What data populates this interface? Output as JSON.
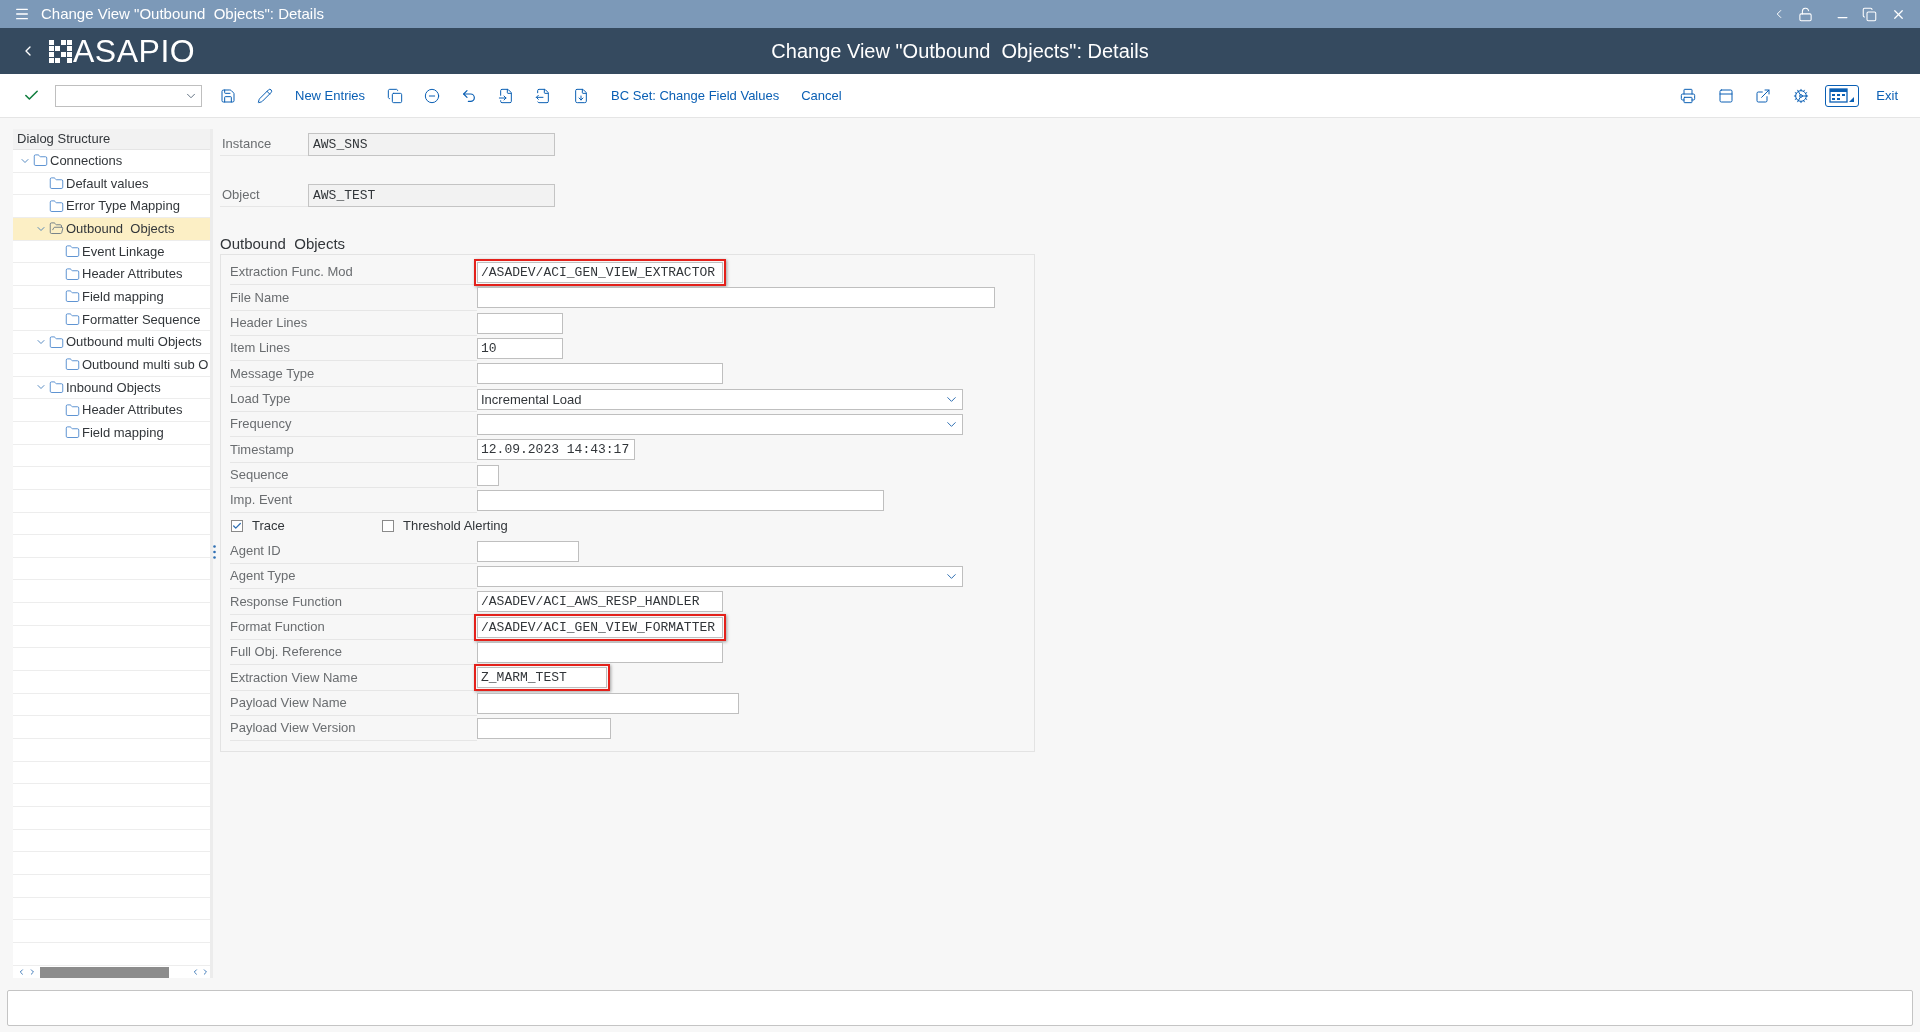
{
  "window": {
    "title": "Change View \"Outbound  Objects\": Details"
  },
  "header": {
    "logo": "ASAPIO",
    "title": "Change View \"Outbound  Objects\": Details"
  },
  "toolbar": {
    "buttons": [
      "New Entries",
      "BC Set: Change Field Values",
      "Cancel"
    ],
    "exit": "Exit"
  },
  "sidebar": {
    "title": "Dialog Structure",
    "items": [
      {
        "label": "Connections",
        "expanded": true,
        "selected": false,
        "children": [
          {
            "label": "Default values",
            "selected": false
          },
          {
            "label": "Error Type Mapping",
            "selected": false
          },
          {
            "label": "Outbound  Objects",
            "expanded": true,
            "selected": true,
            "children": [
              {
                "label": "Event Linkage",
                "selected": false
              },
              {
                "label": "Header Attributes",
                "selected": false
              },
              {
                "label": "Field mapping",
                "selected": false
              },
              {
                "label": "Formatter Sequence",
                "selected": false
              }
            ]
          },
          {
            "label": "Outbound multi Objects",
            "expanded": true,
            "selected": false,
            "children": [
              {
                "label": "Outbound multi sub O",
                "selected": false
              }
            ]
          },
          {
            "label": "Inbound Objects",
            "expanded": true,
            "selected": false,
            "children": [
              {
                "label": "Header Attributes",
                "selected": false
              },
              {
                "label": "Field mapping",
                "selected": false
              }
            ]
          }
        ]
      }
    ]
  },
  "key_fields": [
    {
      "label": "Instance",
      "value": "AWS_SNS"
    },
    {
      "label": "Object",
      "value": "AWS_TEST"
    }
  ],
  "section": {
    "title": "Outbound  Objects",
    "fields": [
      {
        "kind": "input",
        "label": "Extraction Func. Mod",
        "value": "/ASADEV/ACI_GEN_VIEW_EXTRACTOR",
        "highlighted": true
      },
      {
        "kind": "input",
        "label": "File Name",
        "highlighted": false
      },
      {
        "kind": "input",
        "label": "Header Lines",
        "highlighted": false
      },
      {
        "kind": "input",
        "label": "Item Lines",
        "value": "10",
        "highlighted": false
      },
      {
        "kind": "input",
        "label": "Message Type",
        "highlighted": false
      },
      {
        "kind": "dropdown",
        "label": "Load Type",
        "value": "Incremental Load",
        "highlighted": false
      },
      {
        "kind": "dropdown",
        "label": "Frequency",
        "highlighted": false
      },
      {
        "kind": "input",
        "label": "Timestamp",
        "value": "12.09.2023 14:43:17",
        "highlighted": false
      },
      {
        "kind": "input",
        "label": "Sequence",
        "highlighted": false
      },
      {
        "kind": "input",
        "label": "Imp. Event",
        "highlighted": false
      },
      {
        "kind": "checkboxes",
        "items": [
          {
            "label": "Trace",
            "checked": true
          },
          {
            "label": "Threshold Alerting",
            "checked": false
          }
        ]
      },
      {
        "kind": "input",
        "label": "Agent ID",
        "highlighted": false
      },
      {
        "kind": "dropdown",
        "label": "Agent Type",
        "highlighted": false
      },
      {
        "kind": "input",
        "label": "Response Function",
        "value": "/ASADEV/ACI_AWS_RESP_HANDLER",
        "highlighted": false
      },
      {
        "kind": "input",
        "label": "Format Function",
        "value": "/ASADEV/ACI_GEN_VIEW_FORMATTER",
        "highlighted": true
      },
      {
        "kind": "input",
        "label": "Full Obj. Reference",
        "highlighted": false
      },
      {
        "kind": "input",
        "label": "Extraction View Name",
        "value": "Z_MARM_TEST",
        "highlighted": true
      },
      {
        "kind": "input",
        "label": "Payload View Name",
        "highlighted": false
      },
      {
        "kind": "input",
        "label": "Payload View Version",
        "highlighted": false
      }
    ]
  }
}
